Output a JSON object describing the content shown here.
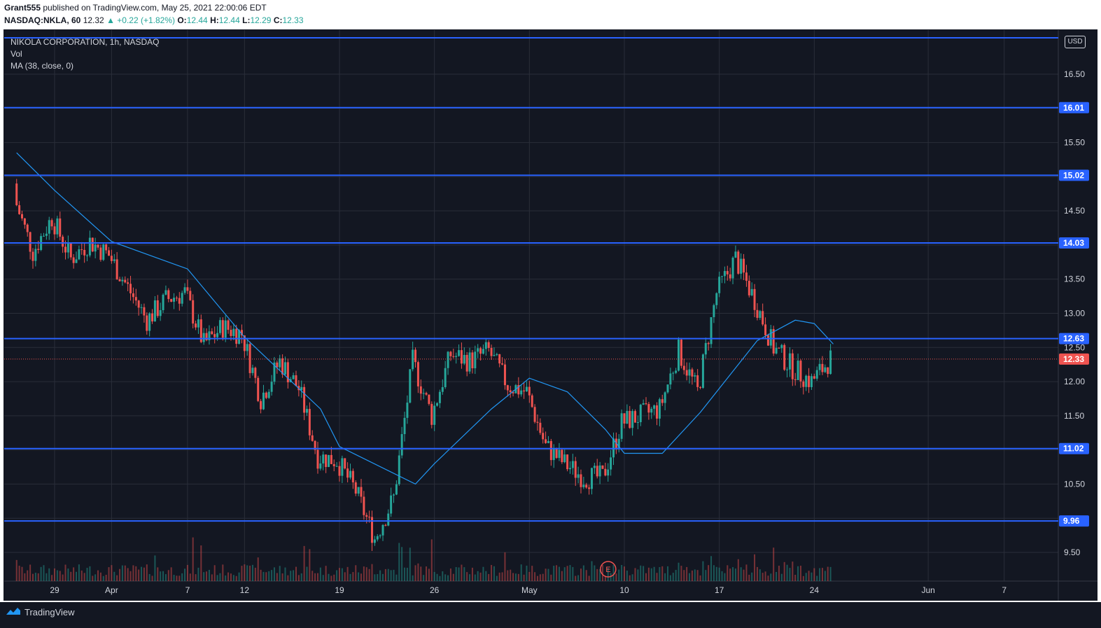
{
  "header": {
    "publisher": "Grant555",
    "published_text": "published on TradingView.com, May 25, 2021 22:00:06 EDT",
    "symbol_interval": "NASDAQ:NKLA, 60",
    "last": "12.32",
    "change": "▲ +0.22 (+1.82%)",
    "o_label": "O:",
    "o_value": "12.44",
    "h_label": "H:",
    "h_value": "12.44",
    "l_label": "L:",
    "l_value": "12.29",
    "c_label": "C:",
    "c_value": "12.33"
  },
  "legend": {
    "title": "NIKOLA CORPORATION, 1h, NASDAQ",
    "vol": "Vol",
    "ma": "MA (38, close, 0)"
  },
  "currency": "USD",
  "brand": "TradingView",
  "colors": {
    "background": "#131722",
    "up": "#26a69a",
    "down": "#ef5350",
    "level_line": "#2962ff",
    "ma_line": "#2196f3",
    "last_price": "#ef5350"
  },
  "chart_data": {
    "type": "candlestick",
    "y_ticks": [
      "9.50",
      "10.50",
      "11.50",
      "12.00",
      "12.50",
      "13.00",
      "13.50",
      "14.50",
      "15.50",
      "16.50"
    ],
    "ylim": [
      9.1,
      17.0
    ],
    "x_ticks": [
      {
        "label": "29",
        "date": "2021-03-29"
      },
      {
        "label": "Apr",
        "date": "2021-04-01"
      },
      {
        "label": "7",
        "date": "2021-04-07"
      },
      {
        "label": "12",
        "date": "2021-04-12"
      },
      {
        "label": "19",
        "date": "2021-04-19"
      },
      {
        "label": "26",
        "date": "2021-04-26"
      },
      {
        "label": "May",
        "date": "2021-05-03"
      },
      {
        "label": "10",
        "date": "2021-05-10"
      },
      {
        "label": "17",
        "date": "2021-05-17"
      },
      {
        "label": "24",
        "date": "2021-05-24"
      },
      {
        "label": "Jun",
        "date": "2021-06-01"
      },
      {
        "label": "7",
        "date": "2021-06-07"
      }
    ],
    "horizontal_levels": [
      "16.01",
      "15.02",
      "14.03",
      "12.63",
      "11.02",
      "9.96"
    ],
    "last_price": "12.33",
    "earnings_marker": "E",
    "close_path": [
      {
        "date": "2021-03-25",
        "close": 14.7
      },
      {
        "date": "2021-03-26",
        "close": 13.9
      },
      {
        "date": "2021-03-29",
        "close": 14.4
      },
      {
        "date": "2021-03-30",
        "close": 13.8
      },
      {
        "date": "2021-03-31",
        "close": 14.05
      },
      {
        "date": "2021-04-01",
        "close": 13.85
      },
      {
        "date": "2021-04-05",
        "close": 12.9
      },
      {
        "date": "2021-04-06",
        "close": 13.2
      },
      {
        "date": "2021-04-07",
        "close": 13.3
      },
      {
        "date": "2021-04-08",
        "close": 12.55
      },
      {
        "date": "2021-04-09",
        "close": 12.8
      },
      {
        "date": "2021-04-12",
        "close": 12.7
      },
      {
        "date": "2021-04-13",
        "close": 11.75
      },
      {
        "date": "2021-04-14",
        "close": 12.3
      },
      {
        "date": "2021-04-15",
        "close": 11.9
      },
      {
        "date": "2021-04-16",
        "close": 10.9
      },
      {
        "date": "2021-04-19",
        "close": 10.85
      },
      {
        "date": "2021-04-20",
        "close": 10.4
      },
      {
        "date": "2021-04-21",
        "close": 9.7
      },
      {
        "date": "2021-04-22",
        "close": 10.3
      },
      {
        "date": "2021-04-23",
        "close": 12.3
      },
      {
        "date": "2021-04-26",
        "close": 11.5
      },
      {
        "date": "2021-04-27",
        "close": 12.4
      },
      {
        "date": "2021-04-28",
        "close": 12.3
      },
      {
        "date": "2021-04-29",
        "close": 12.45
      },
      {
        "date": "2021-04-30",
        "close": 11.95
      },
      {
        "date": "2021-05-03",
        "close": 11.85
      },
      {
        "date": "2021-05-04",
        "close": 11.05
      },
      {
        "date": "2021-05-05",
        "close": 10.8
      },
      {
        "date": "2021-05-06",
        "close": 10.6
      },
      {
        "date": "2021-05-07",
        "close": 10.6
      },
      {
        "date": "2021-05-10",
        "close": 11.4
      },
      {
        "date": "2021-05-11",
        "close": 11.5
      },
      {
        "date": "2021-05-12",
        "close": 11.6
      },
      {
        "date": "2021-05-13",
        "close": 12.45
      },
      {
        "date": "2021-05-14",
        "close": 11.85
      },
      {
        "date": "2021-05-17",
        "close": 13.3
      },
      {
        "date": "2021-05-18",
        "close": 13.8
      },
      {
        "date": "2021-05-19",
        "close": 13.2
      },
      {
        "date": "2021-05-20",
        "close": 12.5
      },
      {
        "date": "2021-05-21",
        "close": 12.2
      },
      {
        "date": "2021-05-24",
        "close": 12.0
      },
      {
        "date": "2021-05-25",
        "close": 12.33
      }
    ],
    "ma_path": [
      {
        "date": "2021-03-25",
        "value": 15.35
      },
      {
        "date": "2021-03-29",
        "value": 14.8
      },
      {
        "date": "2021-04-01",
        "value": 14.05
      },
      {
        "date": "2021-04-07",
        "value": 13.65
      },
      {
        "date": "2021-04-12",
        "value": 12.65
      },
      {
        "date": "2021-04-16",
        "value": 11.6
      },
      {
        "date": "2021-04-19",
        "value": 11.05
      },
      {
        "date": "2021-04-23",
        "value": 10.5
      },
      {
        "date": "2021-04-26",
        "value": 10.8
      },
      {
        "date": "2021-04-29",
        "value": 11.6
      },
      {
        "date": "2021-05-03",
        "value": 12.05
      },
      {
        "date": "2021-05-05",
        "value": 11.85
      },
      {
        "date": "2021-05-07",
        "value": 11.3
      },
      {
        "date": "2021-05-10",
        "value": 10.95
      },
      {
        "date": "2021-05-12",
        "value": 10.95
      },
      {
        "date": "2021-05-14",
        "value": 11.55
      },
      {
        "date": "2021-05-17",
        "value": 11.9
      },
      {
        "date": "2021-05-19",
        "value": 12.6
      },
      {
        "date": "2021-05-21",
        "value": 12.9
      },
      {
        "date": "2021-05-24",
        "value": 12.85
      },
      {
        "date": "2021-05-25",
        "value": 12.55
      }
    ]
  }
}
